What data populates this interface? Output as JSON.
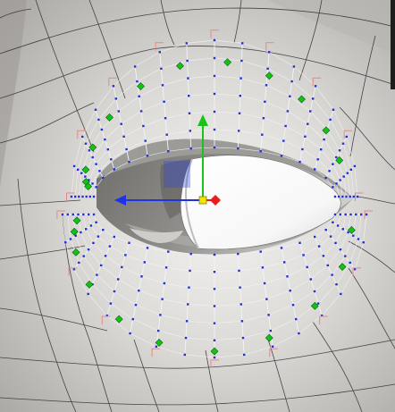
{
  "viewport": {
    "background": "#c9c7c4",
    "mesh_color": "#2d2d2d",
    "skin_light": "#f2f1ef",
    "skin_shadow": "#7d7b78",
    "eye_color": "#ffffff"
  },
  "overlay": {
    "control_vertex_color": "#1f2fd6",
    "selected_handle_color": "#10c417",
    "bracket_color": "#e38a86",
    "curve_color": "#f4f4f4"
  },
  "manipulator": {
    "mode": "translate",
    "x_axis_color": "#e81e1e",
    "y_axis_color": "#18c418",
    "z_axis_color": "#1e32e6",
    "center_color": "#f2e600"
  },
  "upper_handles": [
    {
      "u": 0.08,
      "v": 0.55
    },
    {
      "u": 0.14,
      "v": 0.62
    },
    {
      "u": 0.22,
      "v": 0.7
    },
    {
      "u": 0.32,
      "v": 0.76
    },
    {
      "u": 0.42,
      "v": 0.8
    },
    {
      "u": 0.53,
      "v": 0.8
    },
    {
      "u": 0.63,
      "v": 0.77
    },
    {
      "u": 0.72,
      "v": 0.72
    },
    {
      "u": 0.81,
      "v": 0.64
    },
    {
      "u": 0.89,
      "v": 0.54
    },
    {
      "u": 0.05,
      "v": 0.42
    },
    {
      "u": 0.04,
      "v": 0.3
    }
  ],
  "lower_handles": [
    {
      "u": 0.02,
      "v": 0.55
    },
    {
      "u": 0.05,
      "v": 0.68
    },
    {
      "u": 0.1,
      "v": 0.8
    },
    {
      "u": 0.18,
      "v": 0.88
    },
    {
      "u": 0.28,
      "v": 0.93
    },
    {
      "u": 0.38,
      "v": 0.95
    },
    {
      "u": 0.5,
      "v": 0.94
    },
    {
      "u": 0.62,
      "v": 0.9
    },
    {
      "u": 0.74,
      "v": 0.83
    },
    {
      "u": 0.85,
      "v": 0.73
    },
    {
      "u": 0.95,
      "v": 0.58
    }
  ]
}
